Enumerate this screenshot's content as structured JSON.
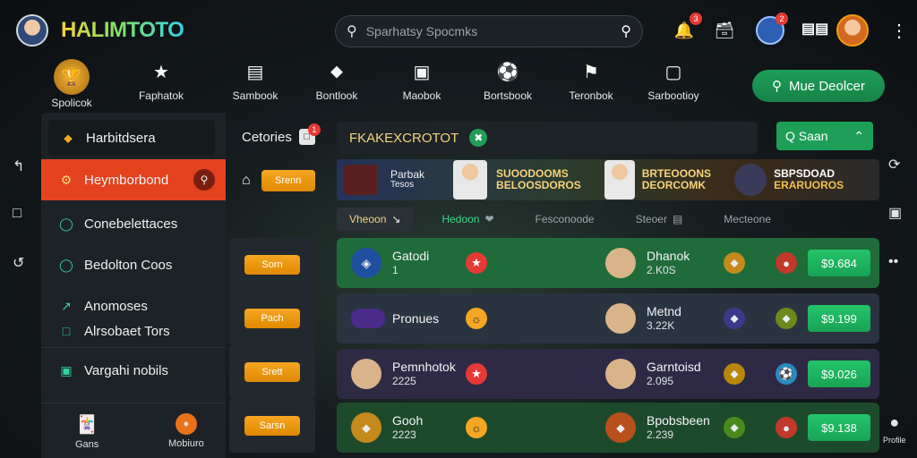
{
  "brand": "HALIMTOTO",
  "search": {
    "placeholder": "Sparhatsy Spocmks"
  },
  "header": {
    "notification_count": "3",
    "cart_count": "2"
  },
  "nav": [
    {
      "label": "Spolicok",
      "icon": "trophy-icon"
    },
    {
      "label": "Faphatok",
      "icon": "star-icon"
    },
    {
      "label": "Sambook",
      "icon": "list-icon"
    },
    {
      "label": "Bontlook",
      "icon": "shield-icon"
    },
    {
      "label": "Maobok",
      "icon": "calendar-icon"
    },
    {
      "label": "Bortsbook",
      "icon": "soccer-ball-icon"
    },
    {
      "label": "Teronbok",
      "icon": "flag-icon"
    },
    {
      "label": "Sarbootioy",
      "icon": "folder-icon"
    }
  ],
  "cta_label": "Mue Deolcer",
  "sidebar": {
    "items": [
      {
        "label": "Harbitdsera"
      },
      {
        "label": "Heymborbond"
      },
      {
        "label": "Conebelettaces"
      },
      {
        "label": "Bedolton Coos"
      },
      {
        "label": "Anomoses"
      },
      {
        "label": "Alrsobaet Tors"
      },
      {
        "label": "Vargahi nobils"
      }
    ]
  },
  "mid": {
    "title": "Cetories",
    "badge": "1",
    "buttons": [
      "Srenn",
      "Sorn",
      "Pach",
      "Srett",
      "Sarsn"
    ]
  },
  "main": {
    "heading": "FKAKEXCROTOT",
    "signin": "Q Saan",
    "banner": {
      "left": [
        "Parbak",
        "Tesos"
      ],
      "center": [
        "SUOODOOMS",
        "BELOOSDOROS"
      ],
      "right": [
        "BRTEOOONS",
        "DEORCOMK"
      ],
      "far": [
        "SBPSDOAD",
        "ERARUOROS"
      ]
    },
    "filters": [
      "Vheoon",
      "Hedoon",
      "Fesconoode",
      "Steoer",
      "Mecteone"
    ]
  },
  "matches": [
    {
      "home": "Gatodi",
      "home_sub": "1",
      "away": "Dhanok",
      "away_sub": "2.K0S",
      "odds": "$9.684",
      "bg": "#1f6b3a"
    },
    {
      "home": "Pronues",
      "home_sub": "",
      "away": "Metnd",
      "away_sub": "3.22K",
      "odds": "$9.199",
      "bg": "#2a3440"
    },
    {
      "home": "Pemnhotok",
      "home_sub": "2225",
      "away": "Garntoisd",
      "away_sub": "2.095",
      "odds": "$9.026",
      "bg": "#2e2a45"
    },
    {
      "home": "Gooh",
      "home_sub": "2223",
      "away": "Bpobsbeen",
      "away_sub": "2.239",
      "odds": "$9.138",
      "bg": "#1e4a2c"
    }
  ],
  "bottom": {
    "games": "Gans",
    "mobile": "Mobiuro",
    "profile": "Profile"
  },
  "colors": {
    "accent_green": "#1f9e58",
    "active_red": "#e5421f",
    "odds_gold": "#f5a623"
  }
}
